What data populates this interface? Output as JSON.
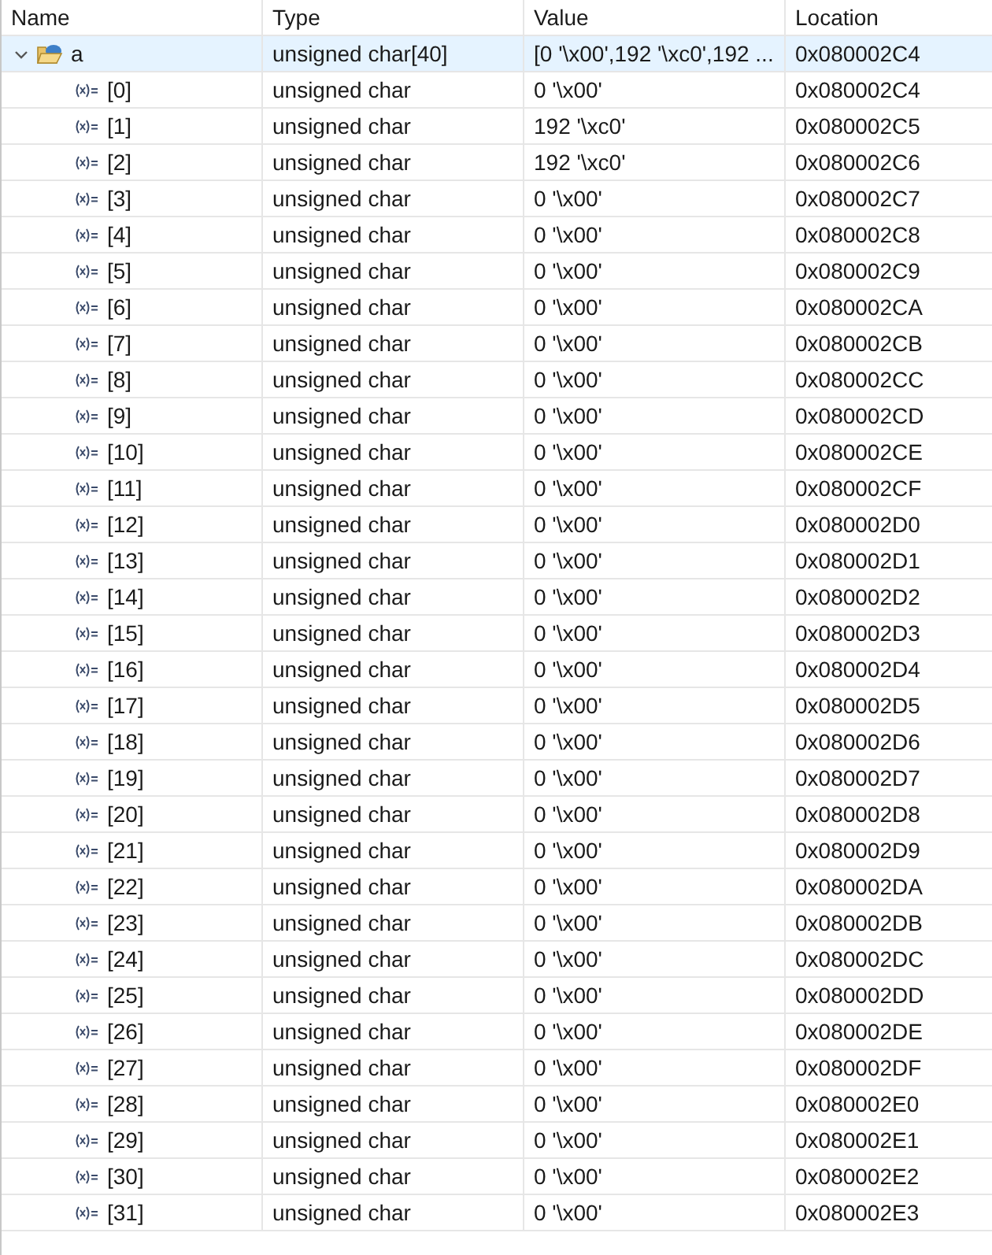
{
  "columns": [
    "Name",
    "Type",
    "Value",
    "Location"
  ],
  "variable": {
    "name": "a",
    "type": "unsigned char[40]",
    "value": "[0 '\\x00',192 '\\xc0',192 ...",
    "location": "0x080002C4",
    "expanded": true,
    "selected": true,
    "children": [
      {
        "name": "[0]",
        "type": "unsigned char",
        "value": "0 '\\x00'",
        "location": "0x080002C4"
      },
      {
        "name": "[1]",
        "type": "unsigned char",
        "value": "192 '\\xc0'",
        "location": "0x080002C5"
      },
      {
        "name": "[2]",
        "type": "unsigned char",
        "value": "192 '\\xc0'",
        "location": "0x080002C6"
      },
      {
        "name": "[3]",
        "type": "unsigned char",
        "value": "0 '\\x00'",
        "location": "0x080002C7"
      },
      {
        "name": "[4]",
        "type": "unsigned char",
        "value": "0 '\\x00'",
        "location": "0x080002C8"
      },
      {
        "name": "[5]",
        "type": "unsigned char",
        "value": "0 '\\x00'",
        "location": "0x080002C9"
      },
      {
        "name": "[6]",
        "type": "unsigned char",
        "value": "0 '\\x00'",
        "location": "0x080002CA"
      },
      {
        "name": "[7]",
        "type": "unsigned char",
        "value": "0 '\\x00'",
        "location": "0x080002CB"
      },
      {
        "name": "[8]",
        "type": "unsigned char",
        "value": "0 '\\x00'",
        "location": "0x080002CC"
      },
      {
        "name": "[9]",
        "type": "unsigned char",
        "value": "0 '\\x00'",
        "location": "0x080002CD"
      },
      {
        "name": "[10]",
        "type": "unsigned char",
        "value": "0 '\\x00'",
        "location": "0x080002CE"
      },
      {
        "name": "[11]",
        "type": "unsigned char",
        "value": "0 '\\x00'",
        "location": "0x080002CF"
      },
      {
        "name": "[12]",
        "type": "unsigned char",
        "value": "0 '\\x00'",
        "location": "0x080002D0"
      },
      {
        "name": "[13]",
        "type": "unsigned char",
        "value": "0 '\\x00'",
        "location": "0x080002D1"
      },
      {
        "name": "[14]",
        "type": "unsigned char",
        "value": "0 '\\x00'",
        "location": "0x080002D2"
      },
      {
        "name": "[15]",
        "type": "unsigned char",
        "value": "0 '\\x00'",
        "location": "0x080002D3"
      },
      {
        "name": "[16]",
        "type": "unsigned char",
        "value": "0 '\\x00'",
        "location": "0x080002D4"
      },
      {
        "name": "[17]",
        "type": "unsigned char",
        "value": "0 '\\x00'",
        "location": "0x080002D5"
      },
      {
        "name": "[18]",
        "type": "unsigned char",
        "value": "0 '\\x00'",
        "location": "0x080002D6"
      },
      {
        "name": "[19]",
        "type": "unsigned char",
        "value": "0 '\\x00'",
        "location": "0x080002D7"
      },
      {
        "name": "[20]",
        "type": "unsigned char",
        "value": "0 '\\x00'",
        "location": "0x080002D8"
      },
      {
        "name": "[21]",
        "type": "unsigned char",
        "value": "0 '\\x00'",
        "location": "0x080002D9"
      },
      {
        "name": "[22]",
        "type": "unsigned char",
        "value": "0 '\\x00'",
        "location": "0x080002DA"
      },
      {
        "name": "[23]",
        "type": "unsigned char",
        "value": "0 '\\x00'",
        "location": "0x080002DB"
      },
      {
        "name": "[24]",
        "type": "unsigned char",
        "value": "0 '\\x00'",
        "location": "0x080002DC"
      },
      {
        "name": "[25]",
        "type": "unsigned char",
        "value": "0 '\\x00'",
        "location": "0x080002DD"
      },
      {
        "name": "[26]",
        "type": "unsigned char",
        "value": "0 '\\x00'",
        "location": "0x080002DE"
      },
      {
        "name": "[27]",
        "type": "unsigned char",
        "value": "0 '\\x00'",
        "location": "0x080002DF"
      },
      {
        "name": "[28]",
        "type": "unsigned char",
        "value": "0 '\\x00'",
        "location": "0x080002E0"
      },
      {
        "name": "[29]",
        "type": "unsigned char",
        "value": "0 '\\x00'",
        "location": "0x080002E1"
      },
      {
        "name": "[30]",
        "type": "unsigned char",
        "value": "0 '\\x00'",
        "location": "0x080002E2"
      },
      {
        "name": "[31]",
        "type": "unsigned char",
        "value": "0 '\\x00'",
        "location": "0x080002E3"
      }
    ]
  }
}
